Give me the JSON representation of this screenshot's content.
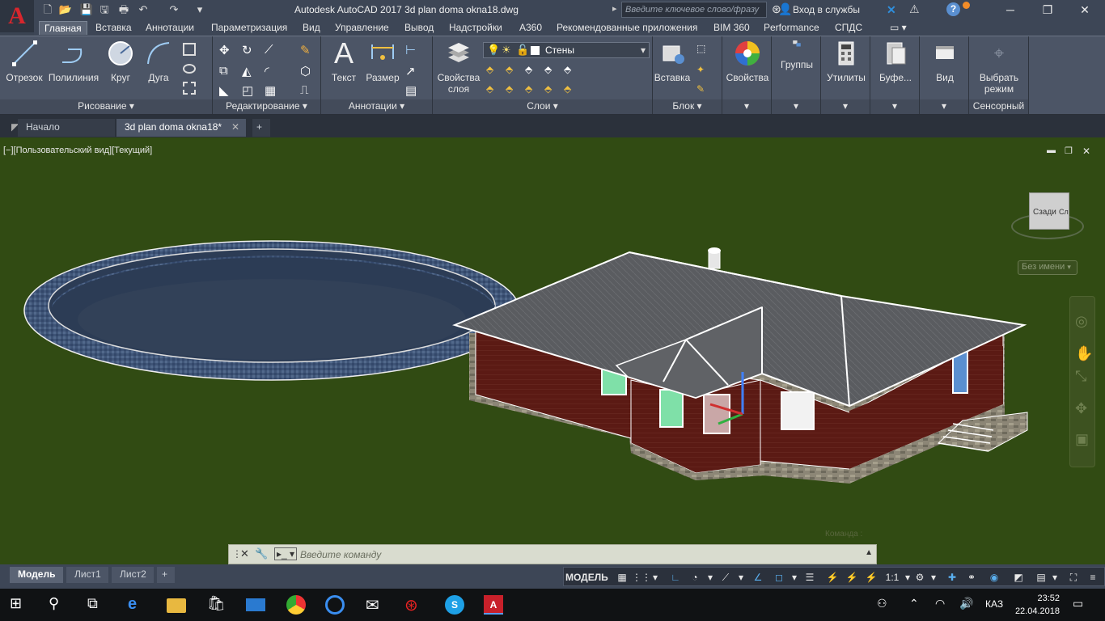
{
  "app": {
    "title": "Autodesk AutoCAD 2017    3d plan doma okna18.dwg",
    "logo": "A"
  },
  "search": {
    "placeholder": "Введите ключевое слово/фразу"
  },
  "account": {
    "login": "Вход в службы"
  },
  "ribbon_tabs": [
    "Главная",
    "Вставка",
    "Аннотации",
    "Параметризация",
    "Вид",
    "Управление",
    "Вывод",
    "Надстройки",
    "A360",
    "Рекомендованные приложения",
    "BIM 360",
    "Performance",
    "СПДС"
  ],
  "panels": {
    "draw": {
      "title": "Рисование ▾",
      "line": "Отрезок",
      "polyline": "Полилиния",
      "circle": "Круг",
      "arc": "Дуга"
    },
    "modify": {
      "title": "Редактирование ▾"
    },
    "annotation": {
      "title": "Аннотации ▾",
      "text": "Текст",
      "dimension": "Размер"
    },
    "layers": {
      "title": "Слои ▾",
      "layer_props": "Свойства слоя",
      "current_layer": "Стены"
    },
    "block": {
      "title": "Блок ▾",
      "insert": "Вставка"
    },
    "properties": {
      "label": "Свойства"
    },
    "groups": {
      "label": "Группы"
    },
    "utilities": {
      "label": "Утилиты"
    },
    "clipboard": {
      "label": "Буфе..."
    },
    "view": {
      "label": "Вид"
    },
    "touch": {
      "title": "Сенсорный",
      "select_mode": "Выбрать режим"
    }
  },
  "doc_tabs": {
    "start": "Начало",
    "current": "3d plan doma okna18*",
    "add": "+"
  },
  "viewport": {
    "label": "[−][Пользовательский вид][Текущий]",
    "viewcube_face": "Сзади",
    "viewcube_side": "Сл",
    "ucs_name": "Без имени"
  },
  "command": {
    "placeholder": "Введите  команду",
    "label": "Команда :"
  },
  "layout_tabs": [
    "Модель",
    "Лист1",
    "Лист2"
  ],
  "status": {
    "model": "МОДЕЛЬ",
    "scale": "1:1"
  },
  "taskbar": {
    "lang": "КАЗ",
    "time": "23:52",
    "date": "22.04.2018"
  }
}
